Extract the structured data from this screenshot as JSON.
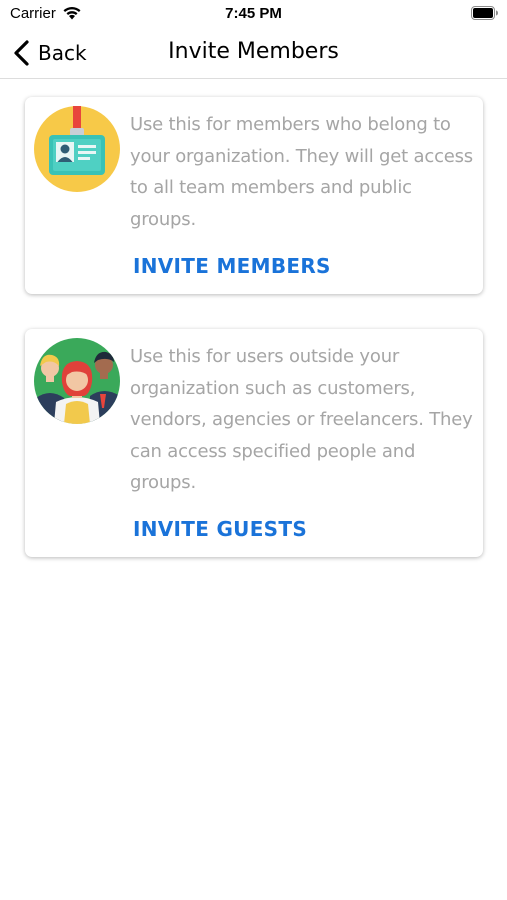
{
  "status_bar": {
    "carrier": "Carrier",
    "time": "7:45 PM"
  },
  "nav": {
    "back_label": "Back",
    "title": "Invite Members"
  },
  "cards": [
    {
      "icon": "id-badge-icon",
      "description": "Use this for members who belong to your organization. They will get access to all team members and public groups.",
      "action": "INVITE MEMBERS"
    },
    {
      "icon": "guest-people-icon",
      "description": "Use this for users outside your organization such as customers, vendors, agencies or freelancers. They can access specified people and groups.",
      "action": "INVITE GUESTS"
    }
  ],
  "colors": {
    "accent": "#1a73d9",
    "description_text": "#a5a5a5",
    "member_icon_bg": "#f7c948",
    "guest_icon_bg": "#3aa95a"
  }
}
